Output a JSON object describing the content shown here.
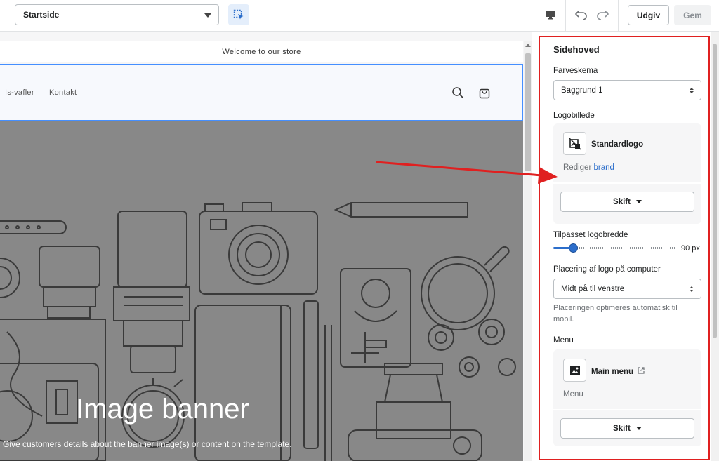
{
  "topbar": {
    "page_select": "Startside",
    "inspect_icon": "select-element-icon",
    "desktop_icon": "desktop-icon",
    "undo_icon": "undo-icon",
    "redo_icon": "redo-icon",
    "publish_label": "Udgiv",
    "save_label": "Gem"
  },
  "preview": {
    "announcement": "Welcome to our store",
    "nav": [
      {
        "label": "Is-vafler"
      },
      {
        "label": "Kontakt"
      }
    ],
    "search_icon": "search-icon",
    "cart_icon": "cart-icon",
    "banner": {
      "title": "Image banner",
      "description": "Give customers details about the banner image(s) or content on the template."
    }
  },
  "panel": {
    "title": "Sidehoved",
    "color_scheme": {
      "label": "Farveskema",
      "value": "Baggrund 1"
    },
    "logo": {
      "label": "Logobillede",
      "name": "Standardlogo",
      "edit_prefix": "Rediger",
      "edit_link": "brand",
      "change_label": "Skift"
    },
    "logo_width": {
      "label": "Tilpasset logobredde",
      "value": 90,
      "display": "90 px",
      "min": 50,
      "max": 300
    },
    "logo_position": {
      "label": "Placering af logo på computer",
      "value": "Midt på til venstre",
      "help": "Placeringen optimeres automatisk til mobil."
    },
    "menu": {
      "label": "Menu",
      "name": "Main menu",
      "sub": "Menu",
      "change_label": "Skift"
    }
  },
  "annotation": {
    "arrow_color": "#e02020",
    "frame_color": "#e02020"
  }
}
